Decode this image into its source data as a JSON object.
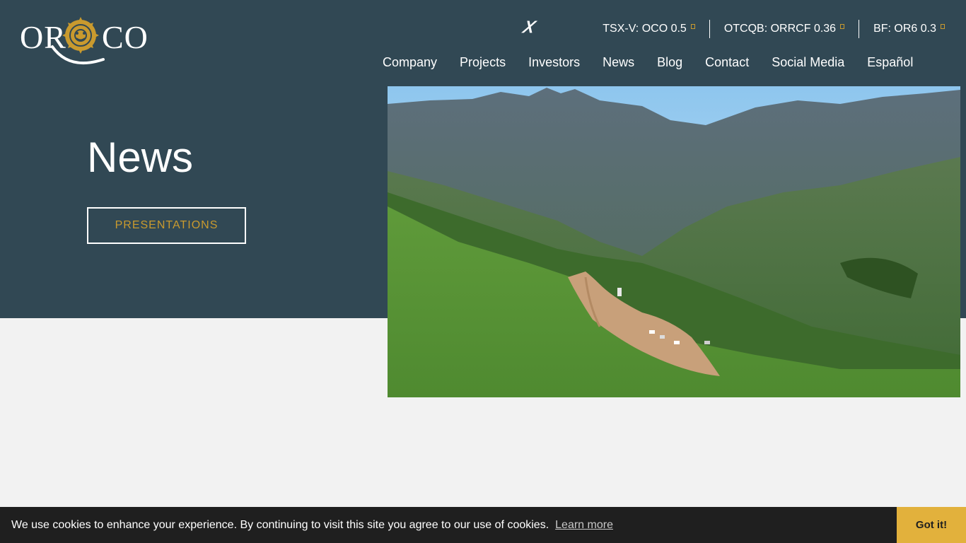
{
  "brand": {
    "logo_left": "OR",
    "logo_right": "CO",
    "accent_color": "#c99a2e",
    "header_bg": "#314854"
  },
  "social": {
    "x_icon": "x-icon"
  },
  "tickers": [
    {
      "label": "TSX-V: OCO 0.5"
    },
    {
      "label": "OTCQB: ORRCF 0.36"
    },
    {
      "label": "BF: OR6 0.3"
    }
  ],
  "nav": {
    "items": [
      {
        "label": "Company"
      },
      {
        "label": "Projects"
      },
      {
        "label": "Investors"
      },
      {
        "label": "News"
      },
      {
        "label": "Blog"
      },
      {
        "label": "Contact"
      },
      {
        "label": "Social Media"
      },
      {
        "label": "Español"
      }
    ]
  },
  "hero": {
    "title": "News",
    "button_label": "PRESENTATIONS",
    "image": "aerial-mountain-drill-site"
  },
  "cookie": {
    "message": "We use cookies to enhance your experience. By continuing to visit this site you agree to our use of cookies.",
    "learn_more": "Learn more",
    "accept_label": "Got it!",
    "accept_color": "#e2b13c"
  }
}
